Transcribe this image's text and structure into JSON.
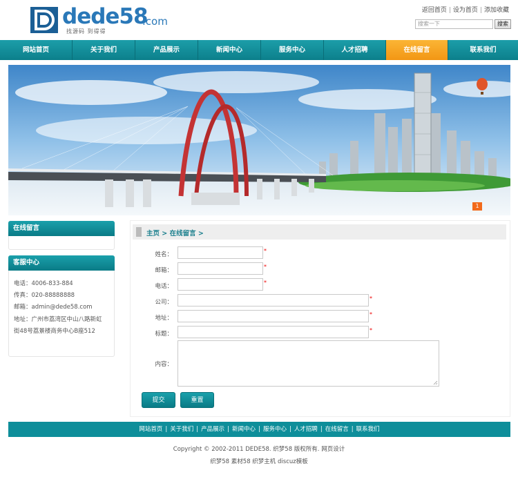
{
  "header": {
    "logo_text": "dede58",
    "logo_suffix": ".com",
    "logo_slogan": "找源码 到得得",
    "top_links": [
      "返回首页",
      "设为首页",
      "添加收藏"
    ],
    "search_placeholder": "搜索一下",
    "search_button": "搜索"
  },
  "nav": {
    "items": [
      "网站首页",
      "关于我们",
      "产品展示",
      "新闻中心",
      "服务中心",
      "人才招聘",
      "在线留言",
      "联系我们"
    ],
    "active_index": 6
  },
  "banner": {
    "slide_number": "1"
  },
  "sidebar": {
    "box1_title": "在线留言",
    "box2_title": "客服中心",
    "contact": {
      "phone": "电话：4006-833-884",
      "fax": "传真：020-88888888",
      "email": "邮箱：admin@dede58.com",
      "address_line1": "地址：广州市荔湾区中山八路新虹",
      "address_line2": "街48号荔景楼商务中心B座512"
    }
  },
  "main": {
    "breadcrumb": "主页 > 在线留言 >",
    "form": {
      "name_label": "姓名：",
      "email_label": "邮箱：",
      "phone_label": "电话：",
      "company_label": "公司：",
      "address_label": "地址：",
      "subject_label": "标题：",
      "content_label": "内容：",
      "required_mark": "*",
      "submit": "提交",
      "reset": "重置"
    }
  },
  "footer": {
    "links": [
      "网站首页",
      "关于我们",
      "产品展示",
      "新闻中心",
      "服务中心",
      "人才招聘",
      "在线留言",
      "联系我们"
    ],
    "copyright": "Copyright © 2002-2011 DEDE58. 织梦58 版权所有. 网页设计",
    "extra": "织梦58 素材58 织梦主机 discuz模板"
  },
  "colors": {
    "brand_teal": "#0e8e9a",
    "nav_active": "#f5a020",
    "logo_blue": "#1b6ea5",
    "required_red": "#ee0000"
  }
}
